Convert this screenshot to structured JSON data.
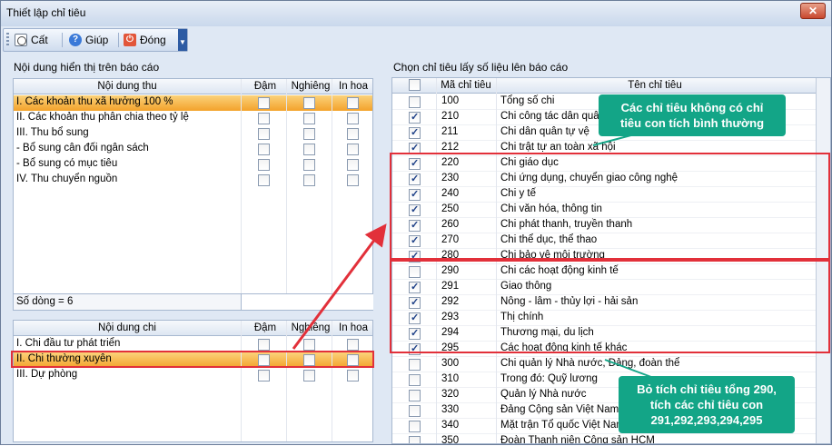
{
  "window": {
    "title": "Thiết lập chỉ tiêu",
    "close_label": "✕"
  },
  "toolbar": {
    "cut_label": "Cất",
    "help_label": "Giúp",
    "close_label": "Đóng"
  },
  "left_top": {
    "section_label": "Nội dung hiển thị trên báo cáo",
    "headers": {
      "content": "Nội dung thu",
      "bold": "Đậm",
      "italic": "Nghiêng",
      "caps": "In hoa"
    },
    "rows": [
      {
        "label": "I. Các khoản thu xã hưởng 100 %",
        "selected": true
      },
      {
        "label": "II. Các khoản thu phân chia theo tỷ lệ"
      },
      {
        "label": "III. Thu bổ sung"
      },
      {
        "label": "- Bổ sung cân đối ngân sách"
      },
      {
        "label": "- Bổ sung có mục tiêu"
      },
      {
        "label": "IV. Thu chuyển nguồn"
      }
    ],
    "footer": "Số dòng = 6"
  },
  "left_bottom": {
    "headers": {
      "content": "Nội dung chi",
      "bold": "Đậm",
      "italic": "Nghiêng",
      "caps": "In hoa"
    },
    "rows": [
      {
        "label": "I. Chi đầu tư phát triển"
      },
      {
        "label": "II. Chi thường xuyên",
        "selected": true
      },
      {
        "label": "III. Dự phòng"
      }
    ]
  },
  "right": {
    "section_label": "Chọn chỉ tiêu lấy số liệu lên báo cáo",
    "headers": {
      "code": "Mã chỉ tiêu",
      "name": "Tên chỉ tiêu"
    },
    "rows": [
      {
        "code": "100",
        "name": "Tổng số chi",
        "checked": false
      },
      {
        "code": "210",
        "name": "Chi công tác dân quân",
        "checked": true
      },
      {
        "code": "211",
        "name": "Chi dân quân tự vệ",
        "checked": true
      },
      {
        "code": "212",
        "name": "Chi trật tự an toàn xã hội",
        "checked": true
      },
      {
        "code": "220",
        "name": "Chi giáo dục",
        "checked": true
      },
      {
        "code": "230",
        "name": "Chi ứng dụng, chuyển giao công nghệ",
        "checked": true
      },
      {
        "code": "240",
        "name": "Chi y tế",
        "checked": true
      },
      {
        "code": "250",
        "name": "Chi văn hóa, thông tin",
        "checked": true
      },
      {
        "code": "260",
        "name": "Chi phát thanh, truyền thanh",
        "checked": true
      },
      {
        "code": "270",
        "name": "Chi thể dục, thể thao",
        "checked": true
      },
      {
        "code": "280",
        "name": "Chi bảo vệ môi trường",
        "checked": true
      },
      {
        "code": "290",
        "name": "Chi các hoạt động kinh tế",
        "checked": false
      },
      {
        "code": "291",
        "name": "Giao thông",
        "checked": true
      },
      {
        "code": "292",
        "name": "Nông - lâm - thủy lợi - hải sản",
        "checked": true
      },
      {
        "code": "293",
        "name": "Thị chính",
        "checked": true
      },
      {
        "code": "294",
        "name": "Thương mại, du lịch",
        "checked": true
      },
      {
        "code": "295",
        "name": "Các hoạt động kinh tế khác",
        "checked": true
      },
      {
        "code": "300",
        "name": "Chi quản lý Nhà nước, Đảng, đoàn thể",
        "checked": false
      },
      {
        "code": "310",
        "name": "Trong đó: Quỹ lương",
        "checked": false
      },
      {
        "code": "320",
        "name": "Quản lý Nhà nước",
        "checked": false
      },
      {
        "code": "330",
        "name": "Đảng Cộng sản Việt Nam",
        "checked": false
      },
      {
        "code": "340",
        "name": "Mặt trận Tổ quốc Việt Nam",
        "checked": false
      },
      {
        "code": "350",
        "name": "Đoàn Thanh niên Cộng sản HCM",
        "checked": false
      }
    ]
  },
  "callouts": {
    "top": [
      "Các chỉ tiêu không có chỉ",
      "tiêu con tích bình thường"
    ],
    "bottom": [
      "Bỏ tích chỉ tiêu tổng 290,",
      "tích các chỉ tiêu con",
      "291,292,293,294,295"
    ]
  },
  "colors": {
    "accent_red": "#e2303a",
    "callout_green": "#13a587",
    "selection_orange": "#f3a22b"
  }
}
